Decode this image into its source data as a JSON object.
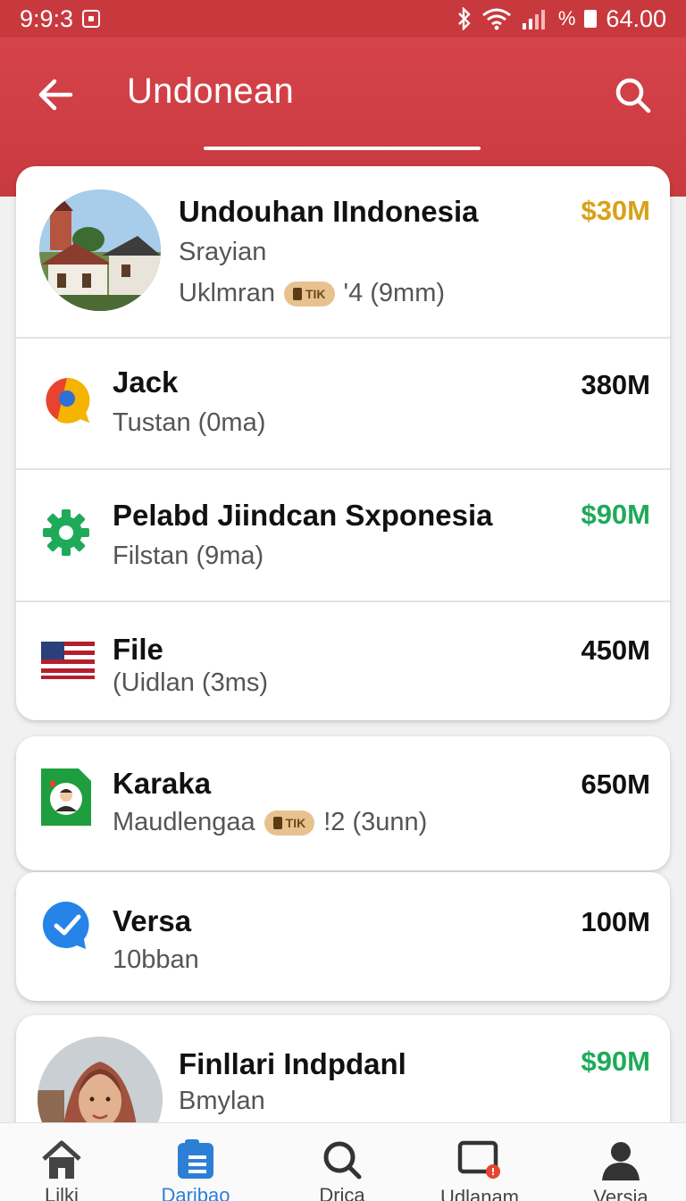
{
  "status_bar": {
    "time": "9:9:3",
    "percent_symbol": "%",
    "battery": "64.00"
  },
  "header": {
    "title": "Undonean"
  },
  "colors": {
    "primary": "#c8393d",
    "gold_value": "#d9a118",
    "green_value": "#1faa59",
    "active_nav": "#2d7fd6"
  },
  "card1": {
    "rows": [
      {
        "title": "Undouhan IIndonesia",
        "sub": "Srayian",
        "sub2_prefix": "Uklmran",
        "badge": "TIK",
        "sub2_suffix": "'4 (9mm)",
        "value": "$30M",
        "value_color": "gold",
        "icon": "house-photo"
      },
      {
        "title": "Jack",
        "sub": "Tustan (0ma)",
        "value": "380M",
        "value_color": "black",
        "icon": "chat-bubble-icon"
      },
      {
        "title": "Pelabd Jiindcan Sxponesia",
        "sub": "Filstan (9ma)",
        "value": "$90M",
        "value_color": "green",
        "icon": "gear-icon"
      },
      {
        "title": "File",
        "sub": "(Uidlan (3ms)",
        "value": "450M",
        "value_color": "black",
        "icon": "flag-icon"
      }
    ]
  },
  "card2": {
    "rows": [
      {
        "title": "Karaka",
        "sub_prefix": "Maudlengaa",
        "badge": "TIK",
        "sub_suffix": "!2 (3unn)",
        "value": "650M",
        "value_color": "black",
        "icon": "contact-card-icon"
      }
    ]
  },
  "card3": {
    "rows": [
      {
        "title": "Versa",
        "sub": "10bban",
        "value": "100M",
        "value_color": "black",
        "icon": "messenger-icon"
      }
    ]
  },
  "card4": {
    "rows": [
      {
        "title": "Finllari Indpdanl",
        "sub": "Bmylan",
        "value": "$90M",
        "value_color": "green",
        "icon": "person-photo"
      }
    ]
  },
  "bottom_nav": [
    {
      "label": "Lilki",
      "icon": "home-icon",
      "active": false
    },
    {
      "label": "Daribao",
      "icon": "document-icon",
      "active": true
    },
    {
      "label": "Drica",
      "icon": "search-icon",
      "active": false
    },
    {
      "label": "Udlanam",
      "icon": "screen-alert-icon",
      "active": false
    },
    {
      "label": "Versia",
      "icon": "profile-icon",
      "active": false
    }
  ]
}
